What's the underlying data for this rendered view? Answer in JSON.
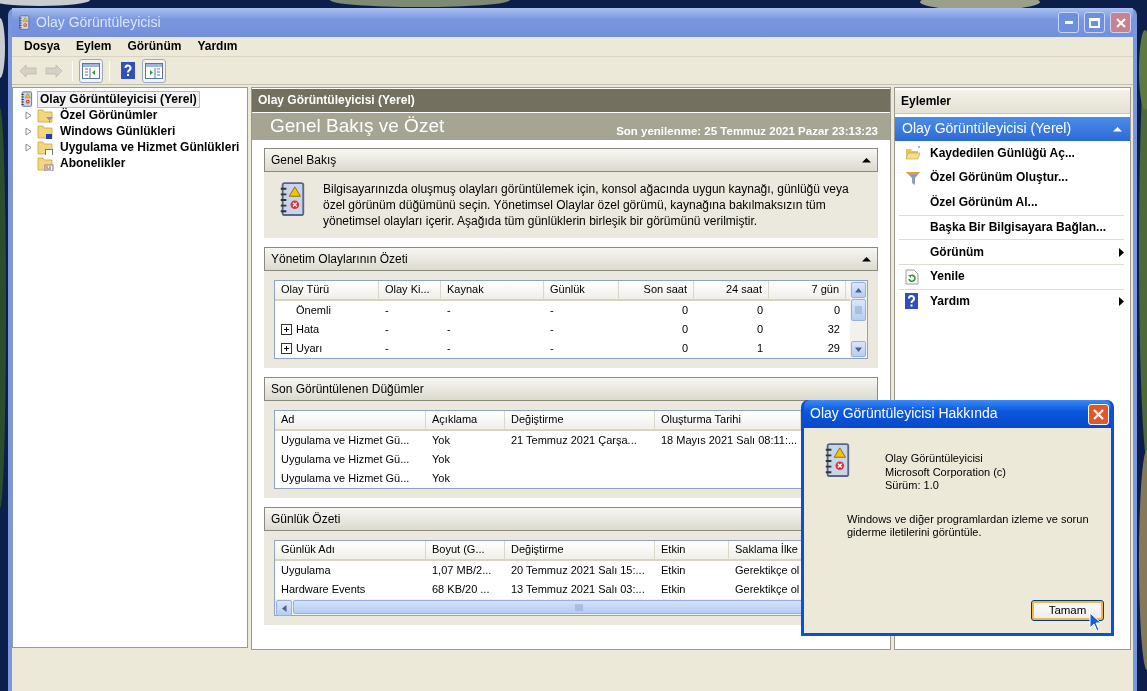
{
  "window": {
    "title": "Olay Görüntüleyicisi",
    "active": false
  },
  "menu": [
    "Dosya",
    "Eylem",
    "Görünüm",
    "Yardım"
  ],
  "toolbar": [
    [
      {
        "kind": "back",
        "disabled": true,
        "pressed": false
      },
      {
        "kind": "forward",
        "disabled": true,
        "pressed": false
      }
    ],
    [
      {
        "kind": "tree",
        "disabled": false,
        "pressed": true
      }
    ],
    [
      {
        "kind": "help",
        "disabled": false,
        "pressed": false
      },
      {
        "kind": "actions",
        "disabled": false,
        "pressed": true
      }
    ]
  ],
  "tree": {
    "label": "Olay Görüntüleyicisi (Yerel)",
    "kind": "root",
    "selected": true,
    "children": [
      {
        "label": "Özel Görünümler",
        "kind": "filter",
        "expandable": true,
        "selected": false
      },
      {
        "label": "Windows Günlükleri",
        "kind": "windows",
        "expandable": true,
        "selected": false
      },
      {
        "label": "Uygulama ve Hizmet Günlükleri",
        "kind": "app",
        "expandable": true,
        "selected": false
      },
      {
        "label": "Abonelikler",
        "kind": "subscriptions",
        "expandable": false,
        "selected": false
      }
    ]
  },
  "panel": {
    "header": "Olay Görüntüleyicisi (Yerel)",
    "title": "Genel Bakış ve Özet",
    "refreshed": "Son yenilenme: 25 Temmuz 2021 Pazar 23:13:23",
    "sections": [
      {
        "kind": "text",
        "title": "Genel Bakış",
        "expanded": true,
        "text": "Bilgisayarınızda oluşmuş olayları görüntülemek için, konsol ağacında uygun kaynağı, günlüğü veya özel görünüm düğümünü seçin. Yönetimsel Olaylar özel görümü, kaynağına bakılmaksızın tüm yönetimsel olayları içerir. Aşağıda tüm günlüklerin birleşik bir görümünü verilmiştir."
      },
      {
        "kind": "table",
        "title": "Yönetim Olaylarının Özeti",
        "expanded": true,
        "vertical_scroll": true,
        "columns": [
          {
            "label": "Olay Türü",
            "numeric": false
          },
          {
            "label": "Olay Ki...",
            "numeric": false
          },
          {
            "label": "Kaynak",
            "numeric": false
          },
          {
            "label": "Günlük",
            "numeric": false
          },
          {
            "label": "Son saat",
            "numeric": true
          },
          {
            "label": "24 saat",
            "numeric": true
          },
          {
            "label": "7 gün",
            "numeric": true
          }
        ],
        "rows": [
          {
            "expandable": false,
            "cells": [
              "Önemli",
              "-",
              "-",
              "-",
              "0",
              "0",
              "0"
            ]
          },
          {
            "expandable": true,
            "cells": [
              "Hata",
              "-",
              "-",
              "-",
              "0",
              "0",
              "32"
            ]
          },
          {
            "expandable": true,
            "cells": [
              "Uyarı",
              "-",
              "-",
              "-",
              "0",
              "1",
              "29"
            ]
          }
        ]
      },
      {
        "kind": "table",
        "title": "Son Görüntülenen Düğümler",
        "columns": [
          {
            "label": "Ad",
            "numeric": false
          },
          {
            "label": "Açıklama",
            "numeric": false
          },
          {
            "label": "Değiştirme",
            "numeric": false
          },
          {
            "label": "Oluşturma Tarihi",
            "numeric": false
          }
        ],
        "rows": [
          {
            "cells": [
              "Uygulama ve Hizmet Gü...",
              "Yok",
              "21 Temmuz 2021 Çarşa...",
              "18 Mayıs 2021 Salı 08:11:..."
            ]
          },
          {
            "cells": [
              "Uygulama ve Hizmet Gü...",
              "Yok",
              "",
              ""
            ]
          },
          {
            "cells": [
              "Uygulama ve Hizmet Gü...",
              "Yok",
              "",
              ""
            ]
          }
        ]
      },
      {
        "kind": "table",
        "title": "Günlük Özeti",
        "horizontal_scroll": true,
        "columns": [
          {
            "label": "Günlük Adı",
            "numeric": false
          },
          {
            "label": "Boyut (G...",
            "numeric": false
          },
          {
            "label": "Değiştirme",
            "numeric": false
          },
          {
            "label": "Etkin",
            "numeric": false
          },
          {
            "label": "Saklama İlke",
            "numeric": false
          }
        ],
        "rows": [
          {
            "cells": [
              "Uygulama",
              "1,07 MB/2...",
              "20 Temmuz 2021 Salı 15:...",
              "Etkin",
              "Gerektikçe ol"
            ]
          },
          {
            "cells": [
              "Hardware Events",
              "68 KB/20 ...",
              "13 Temmuz 2021 Salı 03:...",
              "Etkin",
              "Gerektikçe ol"
            ]
          }
        ]
      }
    ]
  },
  "actions": {
    "title": "Eylemler",
    "group": "Olay Görüntüleyicisi (Yerel)",
    "expanded": true,
    "items": [
      {
        "label": "Kaydedilen Günlüğü Aç...",
        "kind": "folder",
        "divider": false,
        "submenu": false
      },
      {
        "label": "Özel Görünüm Oluştur...",
        "kind": "filter",
        "divider": false,
        "submenu": false
      },
      {
        "label": "Özel Görünüm Al...",
        "kind": "plain",
        "divider": false,
        "submenu": false
      },
      {
        "label": "Başka Bir Bilgisayara Bağlan...",
        "kind": "plain",
        "divider": true,
        "submenu": false
      },
      {
        "label": "Görünüm",
        "kind": "plain",
        "divider": true,
        "submenu": true
      },
      {
        "label": "Yenile",
        "kind": "refresh",
        "divider": true,
        "submenu": false
      },
      {
        "label": "Yardım",
        "kind": "help",
        "divider": true,
        "submenu": true
      }
    ]
  },
  "dialog": {
    "title": "Olay Görüntüleyicisi Hakkında",
    "lines": [
      "Olay Görüntüleyicisi",
      "Microsoft Corporation (c)",
      "Sürüm: 1.0"
    ],
    "description": "Windows ve diğer programlardan izleme ve sorun giderme iletilerini görüntüle.",
    "button": {
      "label": "Tamam",
      "focused": true
    }
  }
}
